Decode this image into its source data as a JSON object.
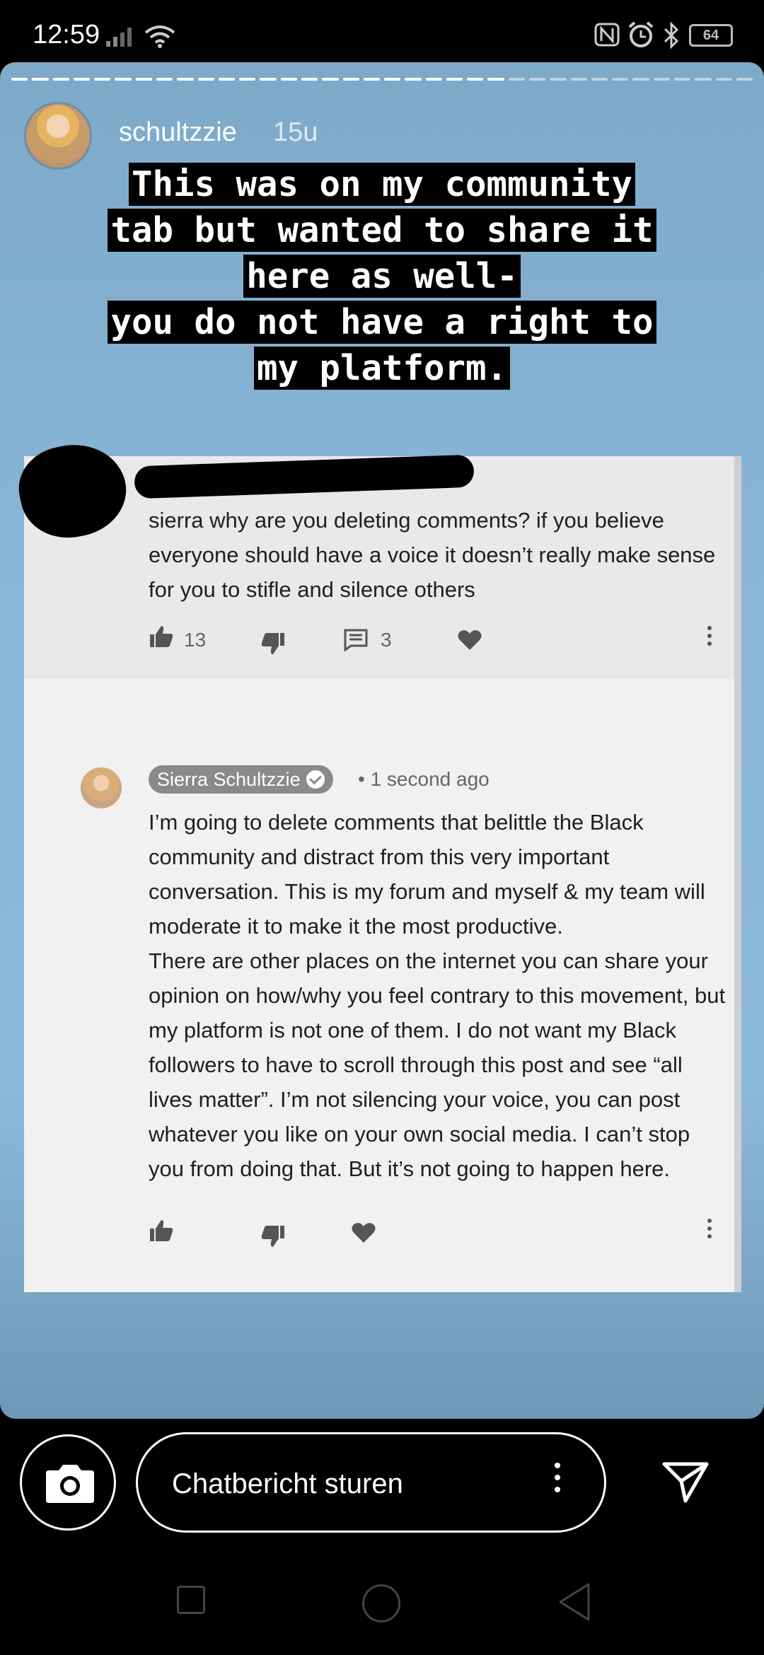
{
  "status_bar": {
    "time": "12:59",
    "battery": "64"
  },
  "story": {
    "username": "schultzzie",
    "time_ago": "15u",
    "caption_lines": [
      "This was on my community",
      "tab but wanted to share it",
      "here as well-",
      "you do not have a right to",
      "my platform."
    ]
  },
  "screenshot": {
    "comment1": {
      "text": "sierra why are you deleting comments? if you believe everyone should have a voice it doesn’t really make sense for you to stifle and silence others",
      "likes": "13",
      "replies": "3"
    },
    "comment2": {
      "author": "Sierra Schultzzie",
      "meta": "• 1 second ago",
      "text_para1": "I’m going to delete comments that belittle the Black community and distract from this very important conversation. This is my forum and myself & my team will moderate it to make it the most productive.",
      "text_para2": "There are other places on the internet you can share your opinion on how/why you feel contrary to this movement, but my platform is not one of them. I do not want my Black followers to have to scroll through this post and see “all lives matter”. I’m not silencing your voice, you can post whatever you like on your own social media. I can’t stop you from doing that. But it’s not going to happen here."
    }
  },
  "reply_bar": {
    "placeholder": "Chatbericht sturen"
  },
  "icons": [
    "signal-icon",
    "wifi-icon",
    "nfc-icon",
    "alarm-icon",
    "bluetooth-icon",
    "battery-icon",
    "camera-icon",
    "more-vertical-icon",
    "send-icon",
    "thumb-up-icon",
    "thumb-down-icon",
    "comment-icon",
    "heart-icon"
  ]
}
